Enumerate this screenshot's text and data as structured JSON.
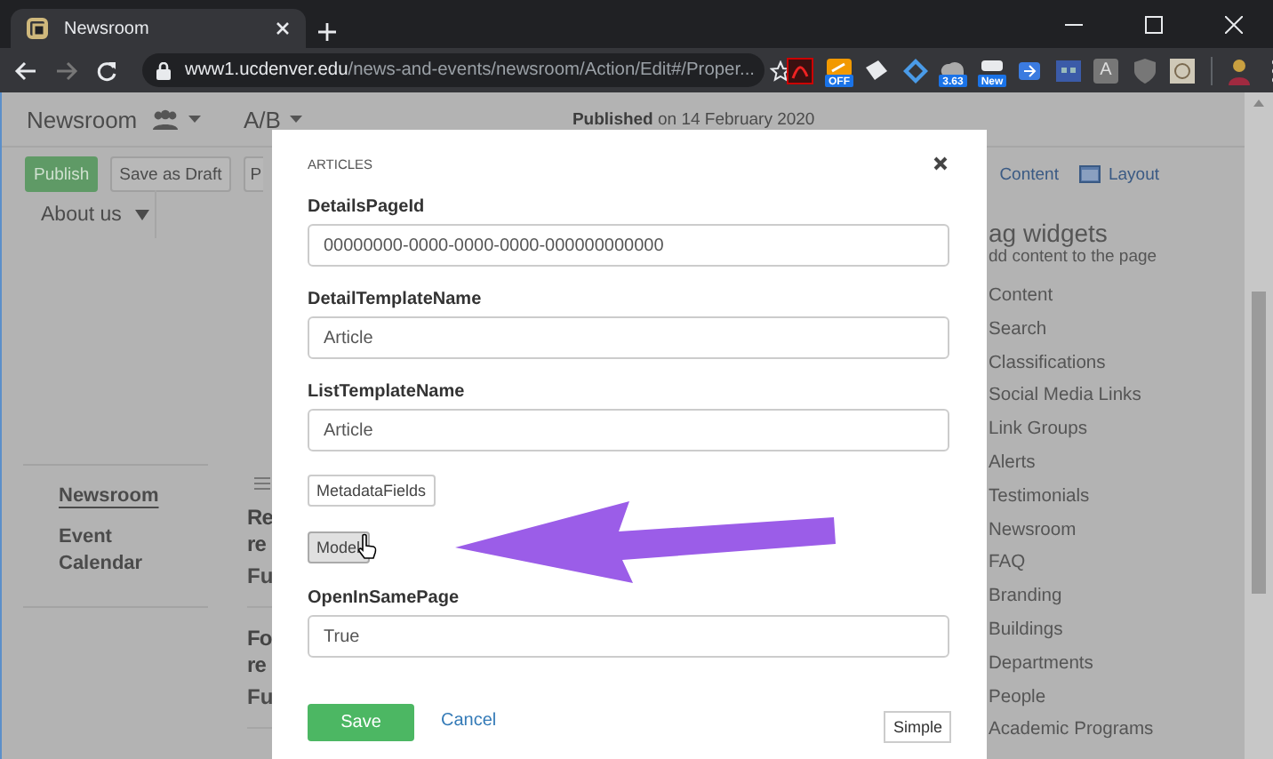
{
  "browser": {
    "tab_title": "Newsroom",
    "url_host": "www1.ucdenver.edu",
    "url_path": "/news-and-events/newsroom/Action/Edit#/Proper...",
    "extensions": [
      {
        "kind": "pdf"
      },
      {
        "kind": "toggle",
        "badge": "OFF"
      },
      {
        "kind": "tag"
      },
      {
        "kind": "diamond"
      },
      {
        "kind": "cloud",
        "badge": "3.63"
      },
      {
        "kind": "box",
        "badge": "New"
      },
      {
        "kind": "arrowbox"
      },
      {
        "kind": "grid"
      },
      {
        "kind": "letter",
        "glyph": "A"
      },
      {
        "kind": "shield"
      },
      {
        "kind": "stamp"
      },
      {
        "kind": "person"
      }
    ]
  },
  "page": {
    "title": "Newsroom",
    "variant": "A/B",
    "status_word": "Published",
    "status_date": "on 14 February 2020",
    "toolbar_buttons": [
      {
        "label": "Publish",
        "kind": "primary"
      },
      {
        "label": "Save as Draft",
        "kind": "default"
      },
      {
        "label": "P",
        "kind": "default"
      }
    ],
    "view_links": [
      {
        "label": "Content",
        "kind": "content"
      },
      {
        "label": "Layout",
        "kind": "layout"
      }
    ],
    "menu": "About us",
    "side_nav": [
      {
        "label": "Newsroom",
        "selected": true
      },
      {
        "label": "Event Calendar",
        "selected": false
      }
    ],
    "articles": [
      {
        "title_lines": [
          "Re",
          "re"
        ],
        "meta": "Fu"
      },
      {
        "title_lines": [
          "Fo",
          "re"
        ],
        "meta": "Fu"
      }
    ],
    "widgets": {
      "title": "ag widgets",
      "subtitle": "dd content to the page",
      "items": [
        "Content",
        "Search",
        "Classifications",
        "Social Media Links",
        "Link Groups",
        "Alerts",
        "Testimonials",
        "Newsroom",
        "FAQ",
        "Branding",
        "Buildings",
        "Departments",
        "People",
        "Academic Programs"
      ]
    }
  },
  "modal": {
    "title": "ARTICLES",
    "fields": [
      {
        "kind": "text",
        "label": "DetailsPageId",
        "value": "00000000-0000-0000-0000-000000000000"
      },
      {
        "kind": "text",
        "label": "DetailTemplateName",
        "value": "Article"
      },
      {
        "kind": "text",
        "label": "ListTemplateName",
        "value": "Article"
      },
      {
        "kind": "button",
        "label": "MetadataFields",
        "hovered": false
      },
      {
        "kind": "button",
        "label": "Model",
        "hovered": true
      },
      {
        "kind": "text",
        "label": "OpenInSamePage",
        "value": "True"
      }
    ],
    "save": "Save",
    "cancel": "Cancel",
    "mode_button": "Simple"
  }
}
